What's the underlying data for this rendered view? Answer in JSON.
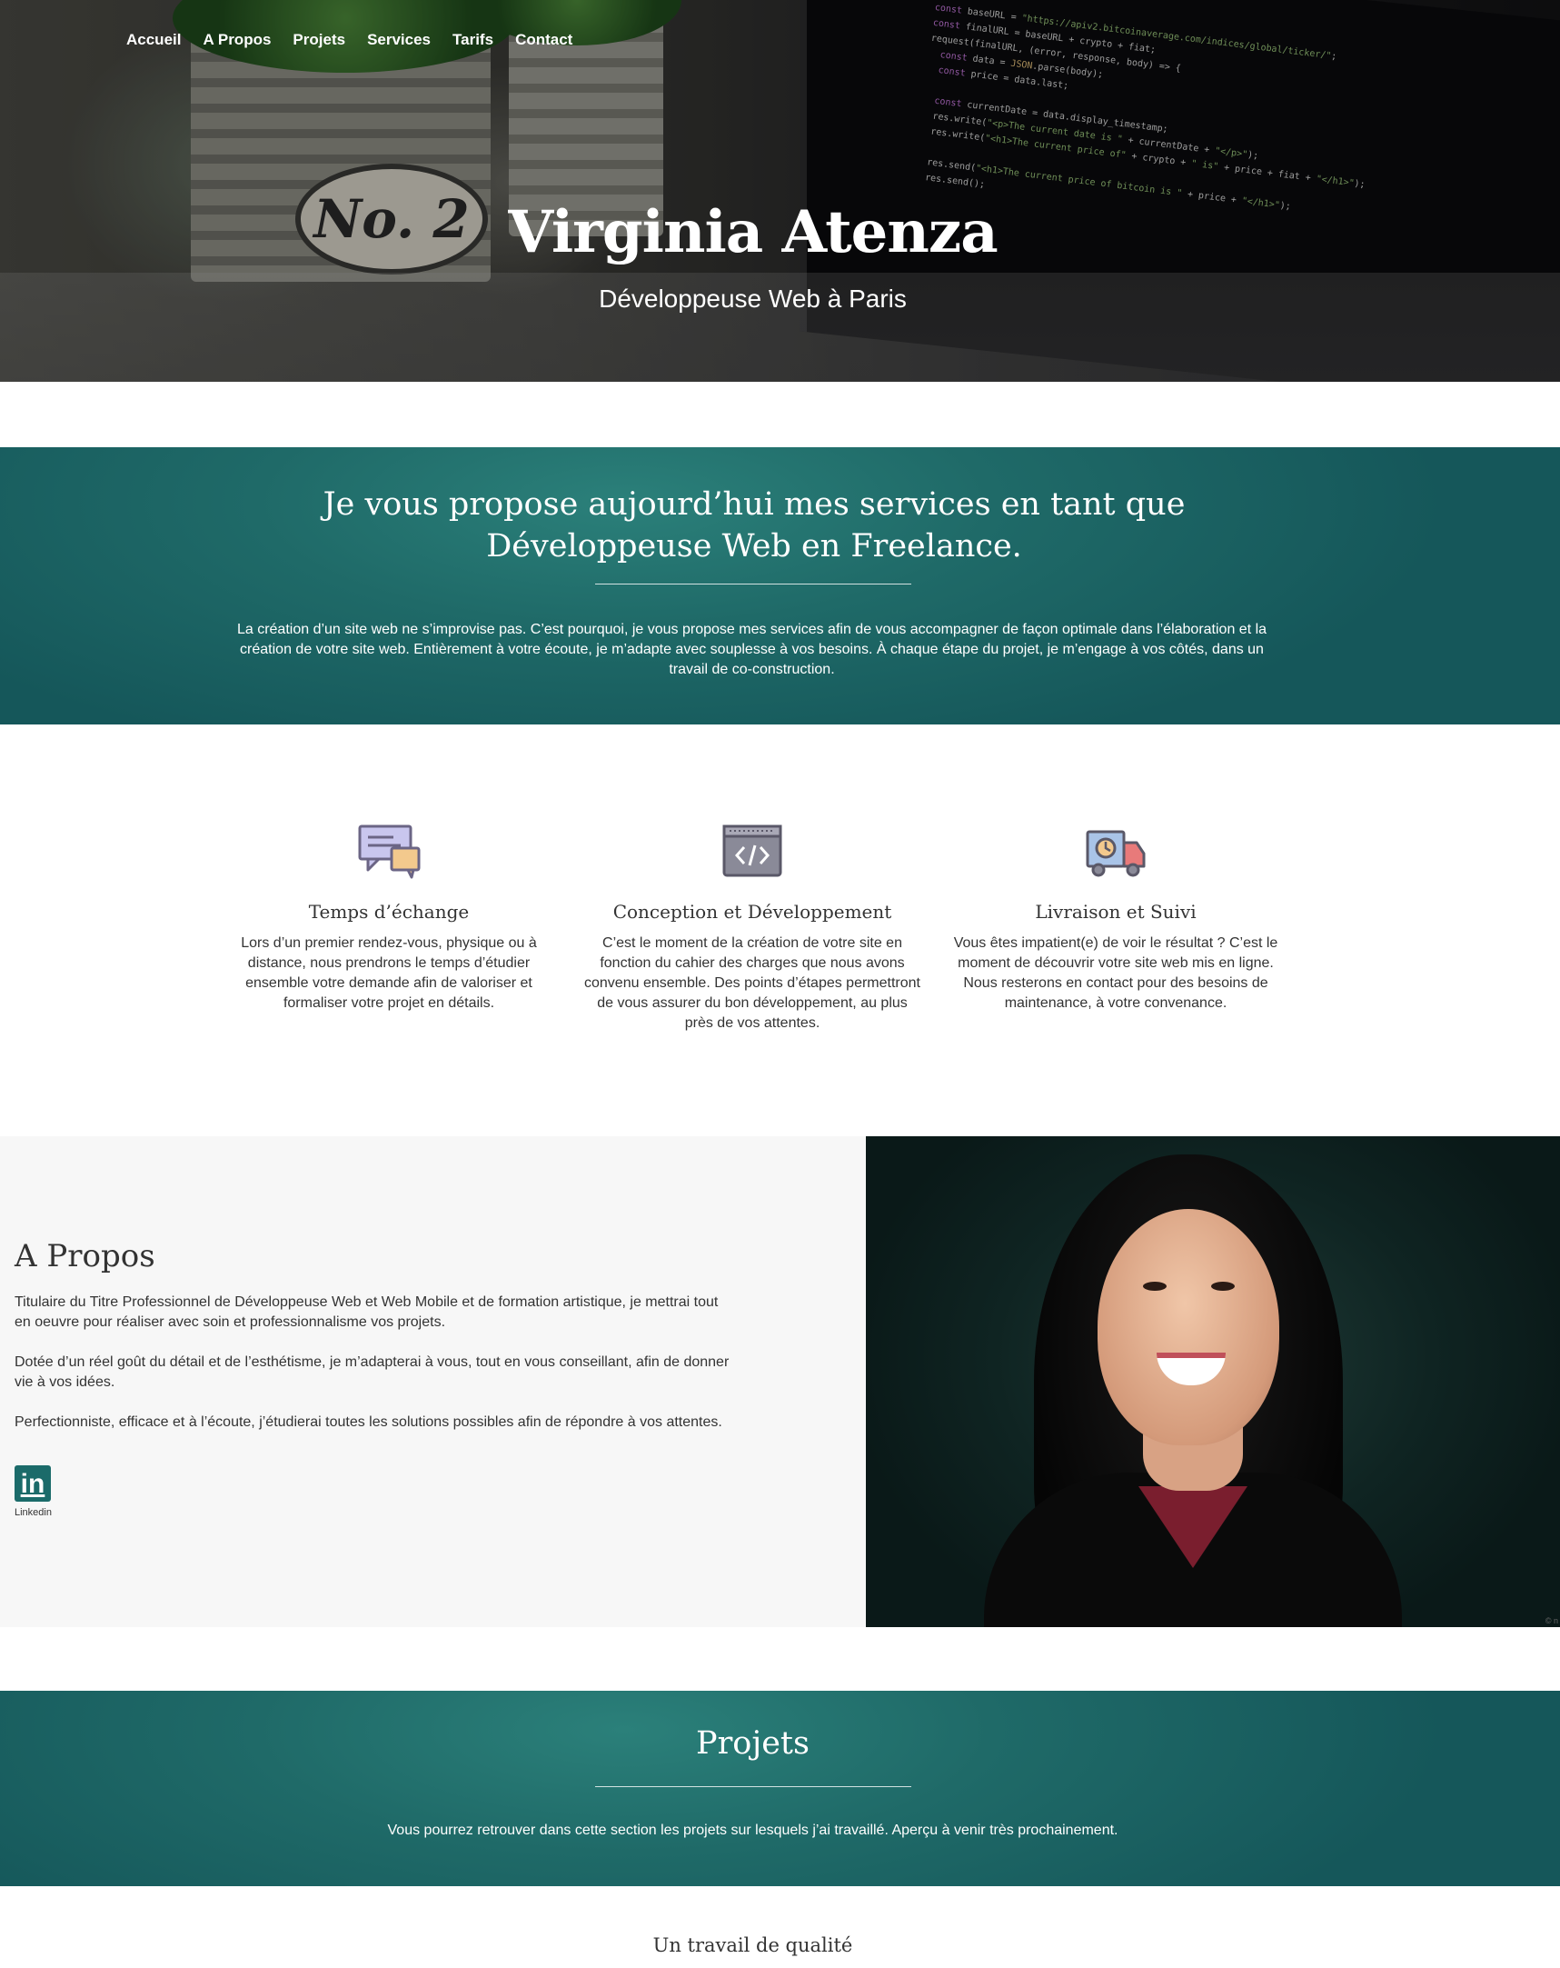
{
  "nav": {
    "items": [
      "Accueil",
      "A Propos",
      "Projets",
      "Services",
      "Tarifs",
      "Contact"
    ]
  },
  "hero": {
    "title": "Virginia Atenza",
    "subtitle": "Développeuse Web à Paris",
    "pot_label": "No. 2"
  },
  "intro": {
    "heading": "Je vous propose aujourd’hui mes services en tant que Développeuse Web en Freelance.",
    "text": "La création d’un site web ne s’improvise pas. C’est pourquoi, je vous propose mes services afin de vous accompagner de façon optimale dans l’élaboration et la création de votre site web. Entièrement à votre écoute, je m’adapte avec souplesse à vos besoins. À chaque étape du projet, je m’engage à vos côtés, dans un travail de co-construction."
  },
  "services": [
    {
      "icon": "chat-bubbles-icon",
      "title": "Temps d’échange",
      "text": "Lors d’un premier rendez-vous, physique ou à distance, nous prendrons le temps d’étudier ensemble votre demande afin de valoriser et formaliser votre projet en détails."
    },
    {
      "icon": "code-window-icon",
      "title": "Conception et Développement",
      "text": "C’est le moment de la création de votre site en fonction du cahier des charges que nous avons convenu ensemble. Des points d’étapes permettront de vous assurer du bon développement, au plus près de vos attentes."
    },
    {
      "icon": "delivery-truck-icon",
      "title": "Livraison et Suivi",
      "text": "Vous êtes impatient(e) de voir le résultat ? C’est le moment de découvrir votre site web mis en ligne. Nous resterons en contact pour des besoins de maintenance, à votre convenance."
    }
  ],
  "about": {
    "heading": "A Propos",
    "paragraphs": [
      "Titulaire du Titre Professionnel de Développeuse Web et Web Mobile et de formation artistique, je mettrai tout en oeuvre pour réaliser avec soin et professionnalisme vos projets.",
      "Dotée d’un réel goût du détail et de l’esthétisme, je m’adapterai à vous, tout en vous conseillant, afin de donner vie à vos idées.",
      "Perfectionniste, efficace et à l’écoute, j’étudierai toutes les solutions possibles afin de répondre à vos attentes."
    ],
    "linkedin_label": "Linkedin",
    "linkedin_glyph": "in",
    "photo_credit": "© n"
  },
  "projects": {
    "heading": "Projets",
    "text": "Vous pourrez retrouver dans cette section les projets sur lesquels j’ai travaillé. Aperçu à venir très prochainement."
  },
  "quality": {
    "heading": "Un travail de qualité"
  },
  "colors": {
    "teal": "#1f6a68",
    "linkedin": "#1b6b6a"
  }
}
